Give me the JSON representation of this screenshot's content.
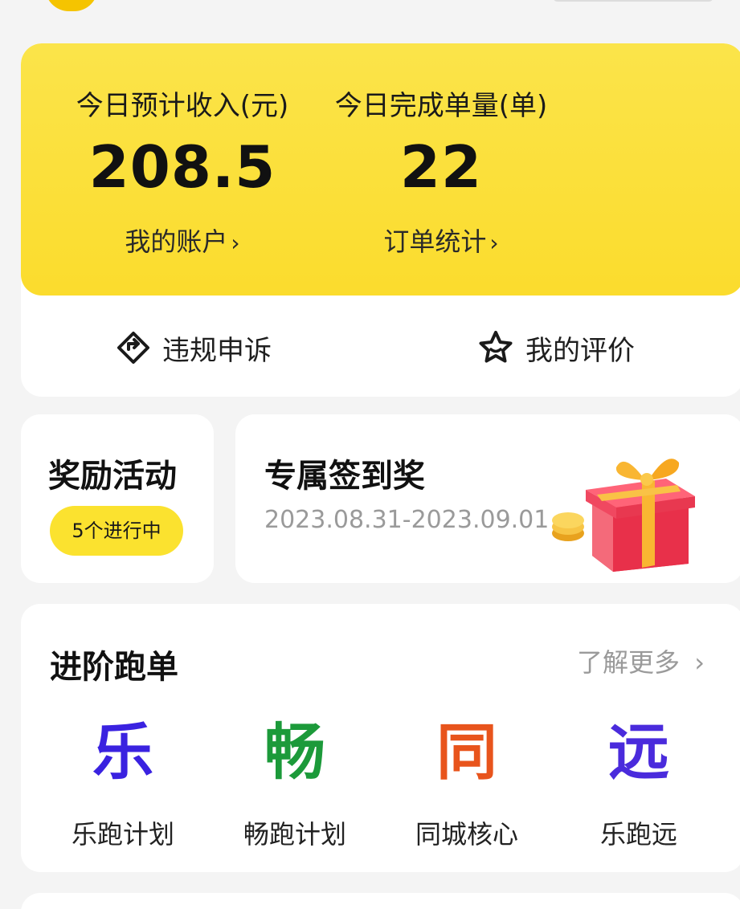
{
  "stats": {
    "income_label": "今日预计收入(元)",
    "income_value": "208.5",
    "account_link": "我的账户",
    "orders_label": "今日完成单量(单)",
    "orders_value": "22",
    "order_stats_link": "订单统计"
  },
  "actions": {
    "appeal": {
      "label": "违规申诉",
      "icon": "diamond-arrow-icon"
    },
    "rating": {
      "label": "我的评价",
      "icon": "star-icon"
    }
  },
  "rewards": {
    "title": "奖励活动",
    "badge": "5个进行中"
  },
  "signin": {
    "title": "专属签到奖",
    "date_range": "2023.08.31-2023.09.01",
    "image": "gift-box-icon"
  },
  "advanced": {
    "title": "进阶跑单",
    "more": "了解更多",
    "items": [
      {
        "glyph": "乐",
        "label": "乐跑计划",
        "color": "#3a22e0"
      },
      {
        "glyph": "畅",
        "label": "畅跑计划",
        "color": "#1c9a3a"
      },
      {
        "glyph": "同",
        "label": "同城核心",
        "color": "#e8541c"
      },
      {
        "glyph": "远",
        "label": "乐跑远",
        "color": "#4a2bdc"
      }
    ]
  },
  "colors": {
    "accent_yellow": "#fbdc2d",
    "background": "#f4f4f4"
  }
}
